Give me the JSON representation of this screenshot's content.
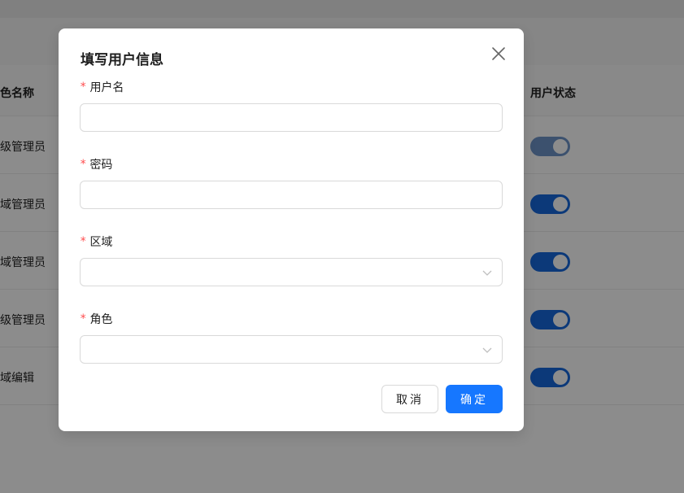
{
  "background_table": {
    "header": {
      "left": "色名称",
      "right": "用户状态"
    },
    "rows": [
      {
        "role": "级管理员",
        "status_on": true
      },
      {
        "role": "域管理员",
        "status_on": true
      },
      {
        "role": "域管理员",
        "status_on": true
      },
      {
        "role": "级管理员",
        "status_on": true
      },
      {
        "role": "域编辑",
        "status_on": true
      }
    ]
  },
  "modal": {
    "title": "填写用户信息",
    "close_icon": "close-icon",
    "required_mark": "*",
    "fields": [
      {
        "label": "用户名",
        "type": "text",
        "value": ""
      },
      {
        "label": "密码",
        "type": "password",
        "value": ""
      },
      {
        "label": "区域",
        "type": "select",
        "value": ""
      },
      {
        "label": "角色",
        "type": "select",
        "value": ""
      }
    ],
    "cancel_label": "取消",
    "ok_label": "确定"
  },
  "colors": {
    "primary": "#1677ff",
    "switch_on": "#1668dc",
    "required": "#ff4d4f",
    "overlay": "rgba(0,0,0,0.45)"
  }
}
